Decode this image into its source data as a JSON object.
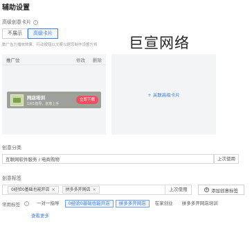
{
  "section_title": "辅助设置",
  "creative_card": {
    "label": "高级创意卡片",
    "help_icon": "?",
    "options": [
      {
        "label": "不展示",
        "active": false
      },
      {
        "label": "高级卡片",
        "active": true
      }
    ],
    "hint": "数广告为播放效果、行动按钮以文案以据您制作设置方将"
  },
  "brand_text": "巨宣网络",
  "ad_preview": {
    "header": {
      "title": "推广位",
      "edit": "修改",
      "delete": "删除"
    },
    "card": {
      "name": "网店培训",
      "sub": "1对1指导，创意上手",
      "button": "立即下载"
    }
  },
  "add_card_link": "+ 关联高级卡片",
  "category": {
    "label": "创意分类",
    "value": "互联网软件服务 / 电商购物",
    "last_used": "上次使用"
  },
  "creative_tags": {
    "label": "创意标签",
    "chips": [
      {
        "text": "0经验0基础也能开店",
        "close": "×"
      },
      {
        "text": "拼多多开网店",
        "close": "×"
      }
    ],
    "last_used": "上次使用",
    "add_button": "添加创意标签"
  },
  "common_tags": {
    "label": "常用标签",
    "items": [
      {
        "text": "一对一指导",
        "selected": false
      },
      {
        "text": "0经验0基础也能开店",
        "selected": true
      },
      {
        "text": "拼多多开网店",
        "selected": true
      },
      {
        "text": "在家创业",
        "selected": false
      },
      {
        "text": "拼多多开网店培训",
        "selected": false
      }
    ],
    "view_more": "查看更多"
  }
}
